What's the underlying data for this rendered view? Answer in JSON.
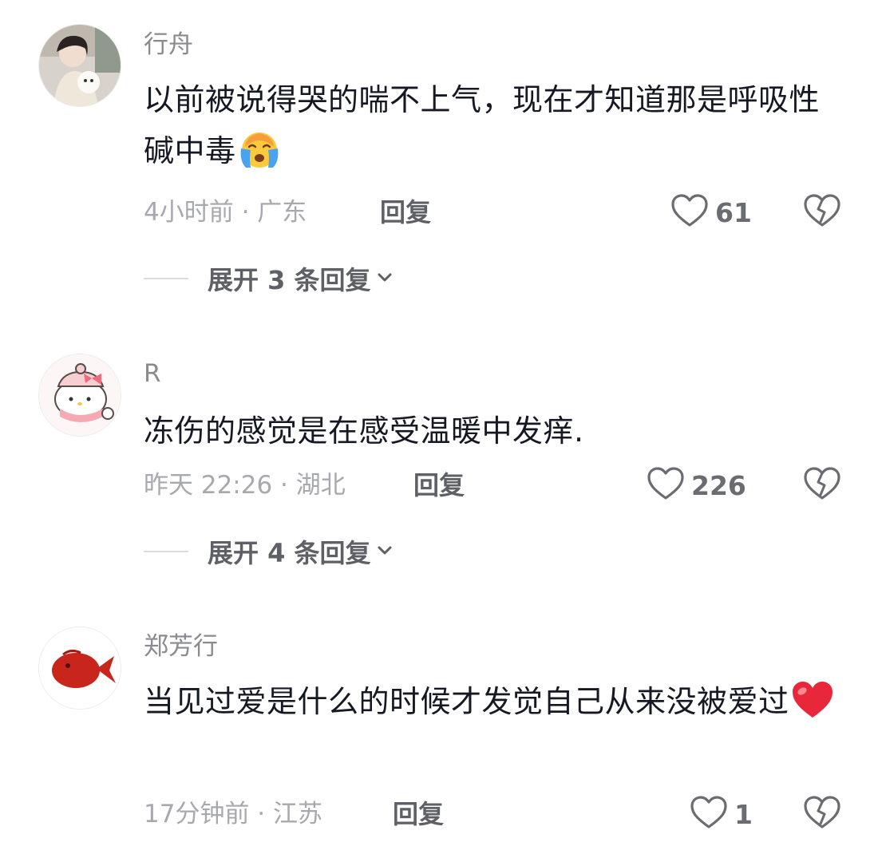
{
  "comments": [
    {
      "username": "行舟",
      "text": "以前被说得哭的喘不上气，现在才知道那是呼吸性碱中毒",
      "emoji": "crying-face",
      "time_location": "4小时前 · 广东",
      "reply_label": "回复",
      "likes": "61",
      "expand_label": "展开 3 条回复",
      "avatar": "photo-of-woman-with-dog"
    },
    {
      "username": "R",
      "text": "冻伤的感觉是在感受温暖中发痒.",
      "time_location": "昨天 22:26 · 湖北",
      "reply_label": "回复",
      "likes": "226",
      "expand_label": "展开 4 条回复",
      "avatar": "hello-kitty-cartoon"
    },
    {
      "username": "郑芳行",
      "text": "当见过爱是什么的时候才发觉自己从来没被爱过",
      "emoji": "red-heart",
      "time_location": "17分钟前 · 江苏",
      "reply_label": "回复",
      "likes": "1",
      "avatar": "red-fish-drawing"
    }
  ],
  "colors": {
    "username": "#8a8b91",
    "body_text": "#161823",
    "meta": "#a8a9ae",
    "action": "#5f6066"
  },
  "icons": {
    "like": "heart-outline-icon",
    "dislike": "broken-heart-icon",
    "expand": "chevron-down-icon"
  }
}
